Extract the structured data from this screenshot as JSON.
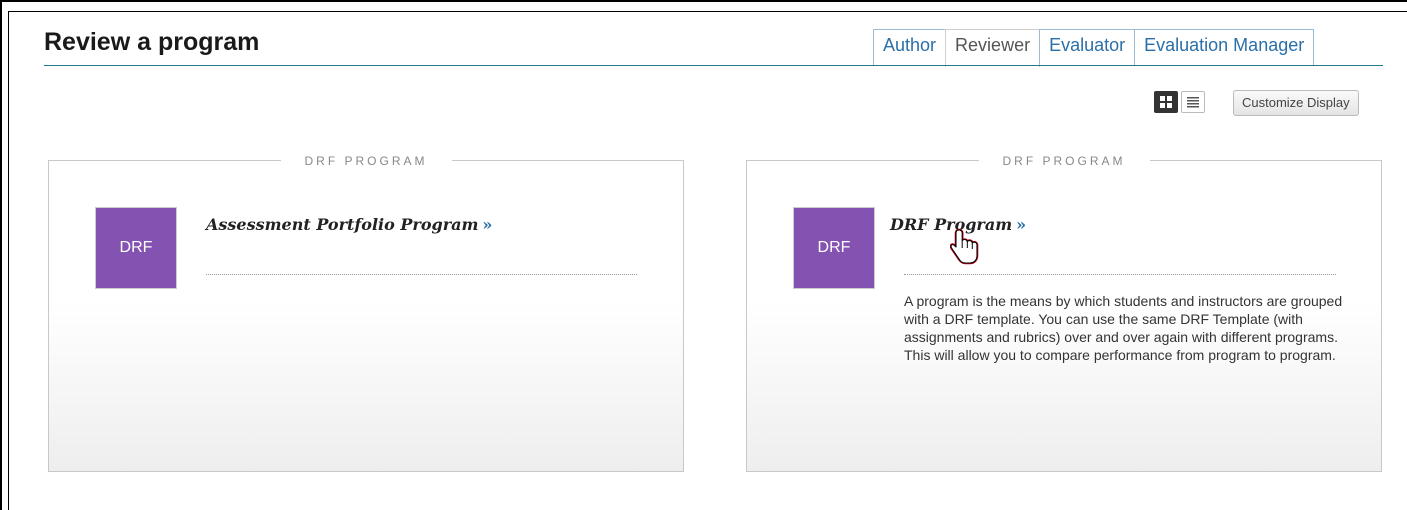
{
  "page": {
    "title": "Review a program"
  },
  "tabs": [
    {
      "label": "Author",
      "active": false
    },
    {
      "label": "Reviewer",
      "active": true
    },
    {
      "label": "Evaluator",
      "active": false
    },
    {
      "label": "Evaluation Manager",
      "active": false
    }
  ],
  "toolbar": {
    "grid_view_icon": "grid-view-icon",
    "list_view_icon": "list-view-icon",
    "customize_label": "Customize Display"
  },
  "cards": [
    {
      "category": "DRF PROGRAM",
      "thumb_label": "DRF",
      "name": "Assessment Portfolio Program",
      "arrow": "»",
      "description": ""
    },
    {
      "category": "DRF PROGRAM",
      "thumb_label": "DRF",
      "name": "DRF Program",
      "arrow": "»",
      "description": "A program is the means by which students and instructors are grouped with a DRF template. You can use the same DRF Template (with assignments and rubrics) over and over again with different programs. This will allow you to compare performance from program to program."
    }
  ],
  "colors": {
    "thumb": "#8452b0",
    "link_arrow": "#2a6fa8",
    "tab_text": "#2a6fa8",
    "title_rule": "#1f7a8c"
  }
}
